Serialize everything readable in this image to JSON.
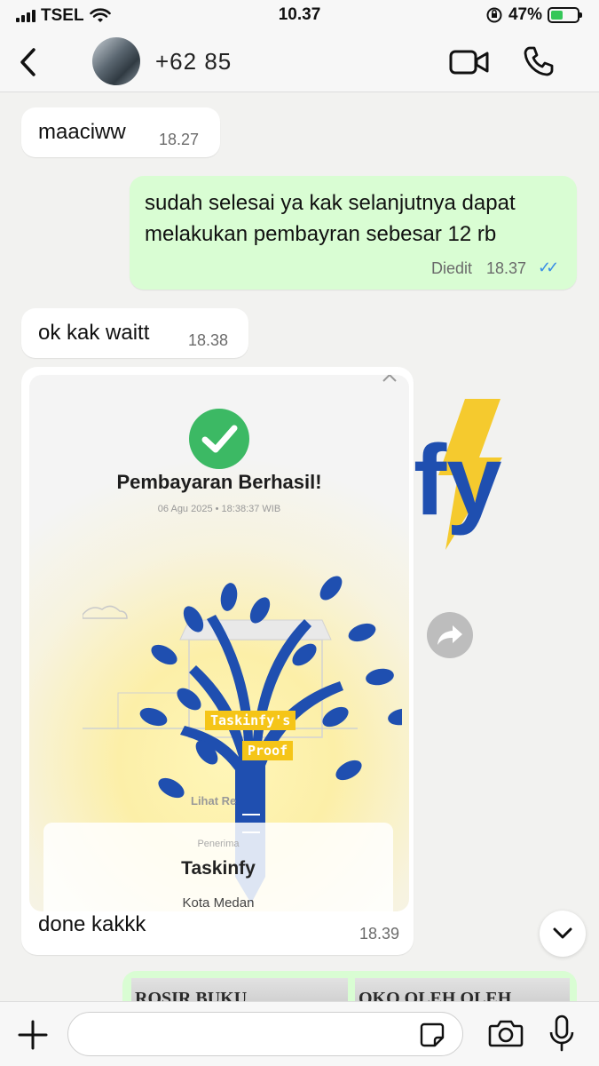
{
  "status_bar": {
    "carrier": "TSEL",
    "time": "10.37",
    "battery": "47%",
    "battery_level": 0.47
  },
  "header": {
    "contact_name": "+62 85",
    "icons": [
      "back-icon",
      "video-call-icon",
      "voice-call-icon"
    ]
  },
  "messages": [
    {
      "direction": "in",
      "text": "maaciww",
      "time": "18.27"
    },
    {
      "direction": "out",
      "text": "sudah selesai ya kak selanjutnya dapat melakukan pembayran sebesar 12 rb",
      "edited_label": "Diedit",
      "time": "18.37",
      "status": "read"
    },
    {
      "direction": "in",
      "text": "ok kak waitt",
      "time": "18.38"
    },
    {
      "direction": "in",
      "type": "image",
      "caption": "done kakkk",
      "time": "18.39",
      "image": {
        "title": "Pembayaran Berhasil!",
        "date": "06 Agu 2025 • 18:38:37 WIB",
        "link_text": "Lihat Re",
        "receiver_label": "Penerima",
        "receiver_name": "Taskinfy",
        "receiver_city": "Kota Medan",
        "watermark_lines": [
          "Taskinfy's",
          "Proof"
        ]
      }
    },
    {
      "direction": "out",
      "type": "images",
      "thumb_texts": [
        "ROSIR BUKU",
        "OKO OLEH OLEH"
      ]
    }
  ],
  "background_logo_text": "fy",
  "colors": {
    "outgoing_bubble": "#d9fdd3",
    "incoming_bubble": "#ffffff",
    "read_tick": "#3a8ee6",
    "success_green": "#3cb964",
    "logo_blue": "#1f4fb0",
    "logo_yellow": "#f5c518"
  },
  "composer": {
    "placeholder": "",
    "value": ""
  }
}
